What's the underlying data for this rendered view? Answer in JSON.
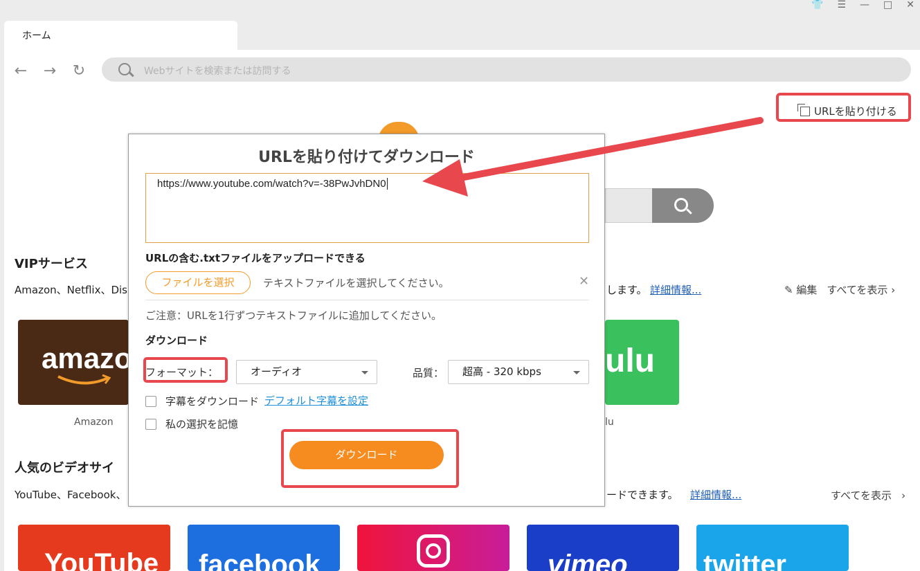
{
  "window": {
    "controls": [
      "shirt-icon",
      "menu-icon",
      "minimize-icon",
      "maximize-icon",
      "close-icon"
    ]
  },
  "tab": {
    "label": "ホーム"
  },
  "browser": {
    "search_placeholder": "Webサイトを検索または訪問する"
  },
  "paste_url": {
    "label": "URLを貼り付ける"
  },
  "vip": {
    "title": "VIPサービス",
    "subtitle": "Amazon、Netflix、Disn",
    "subtitle_right": "します。",
    "more_link": "詳細情報...",
    "edit_label": "編集",
    "show_all": "すべてを表示",
    "tiles": [
      {
        "name": "Amazon",
        "label": "Amazon",
        "text": "amazo",
        "color": "#4a2a15"
      },
      {
        "name": "Hulu",
        "label": "lu",
        "text": "ulu",
        "color": "#3ac05c"
      }
    ]
  },
  "popular": {
    "title": "人気のビデオサイ",
    "subtitle": "YouTube、Facebook、",
    "subtitle_right": "ードできます。",
    "more_link": "詳細情報...",
    "show_all": "すべてを表示",
    "tiles": [
      {
        "name": "YouTube",
        "text": "YouTube",
        "color": "#e53a1e"
      },
      {
        "name": "Facebook",
        "text": "facebook",
        "color": "#1d6fe0"
      },
      {
        "name": "Instagram",
        "text": "",
        "color": "#e0137a"
      },
      {
        "name": "Vimeo",
        "text": "vimeo",
        "color": "#1a3ec8"
      },
      {
        "name": "Twitter",
        "text": "twitter",
        "color": "#1aa5ea"
      }
    ]
  },
  "dialog": {
    "title": "URLを貼り付けてダウンロード",
    "url_value": "https://www.youtube.com/watch?v=-38PwJvhDN0",
    "upload_title": "URLの含む.txtファイルをアップロードできる",
    "file_button": "ファイルを選択",
    "file_hint": "テキストファイルを選択してください。",
    "note": "ご注意：URLを1行ずつテキストファイルに追加してください。",
    "download_heading": "ダウンロード",
    "format_label": "フォーマット：",
    "format_value": "オーディオ",
    "quality_label": "品質：",
    "quality_value": "超高 - 320 kbps",
    "subtitle_checkbox": "字幕をダウンロード",
    "subtitle_link": "デフォルト字幕を設定",
    "remember_checkbox": "私の選択を記憶",
    "download_button": "ダウンロード"
  },
  "annotation": {
    "highlight_color": "#e8474d"
  }
}
